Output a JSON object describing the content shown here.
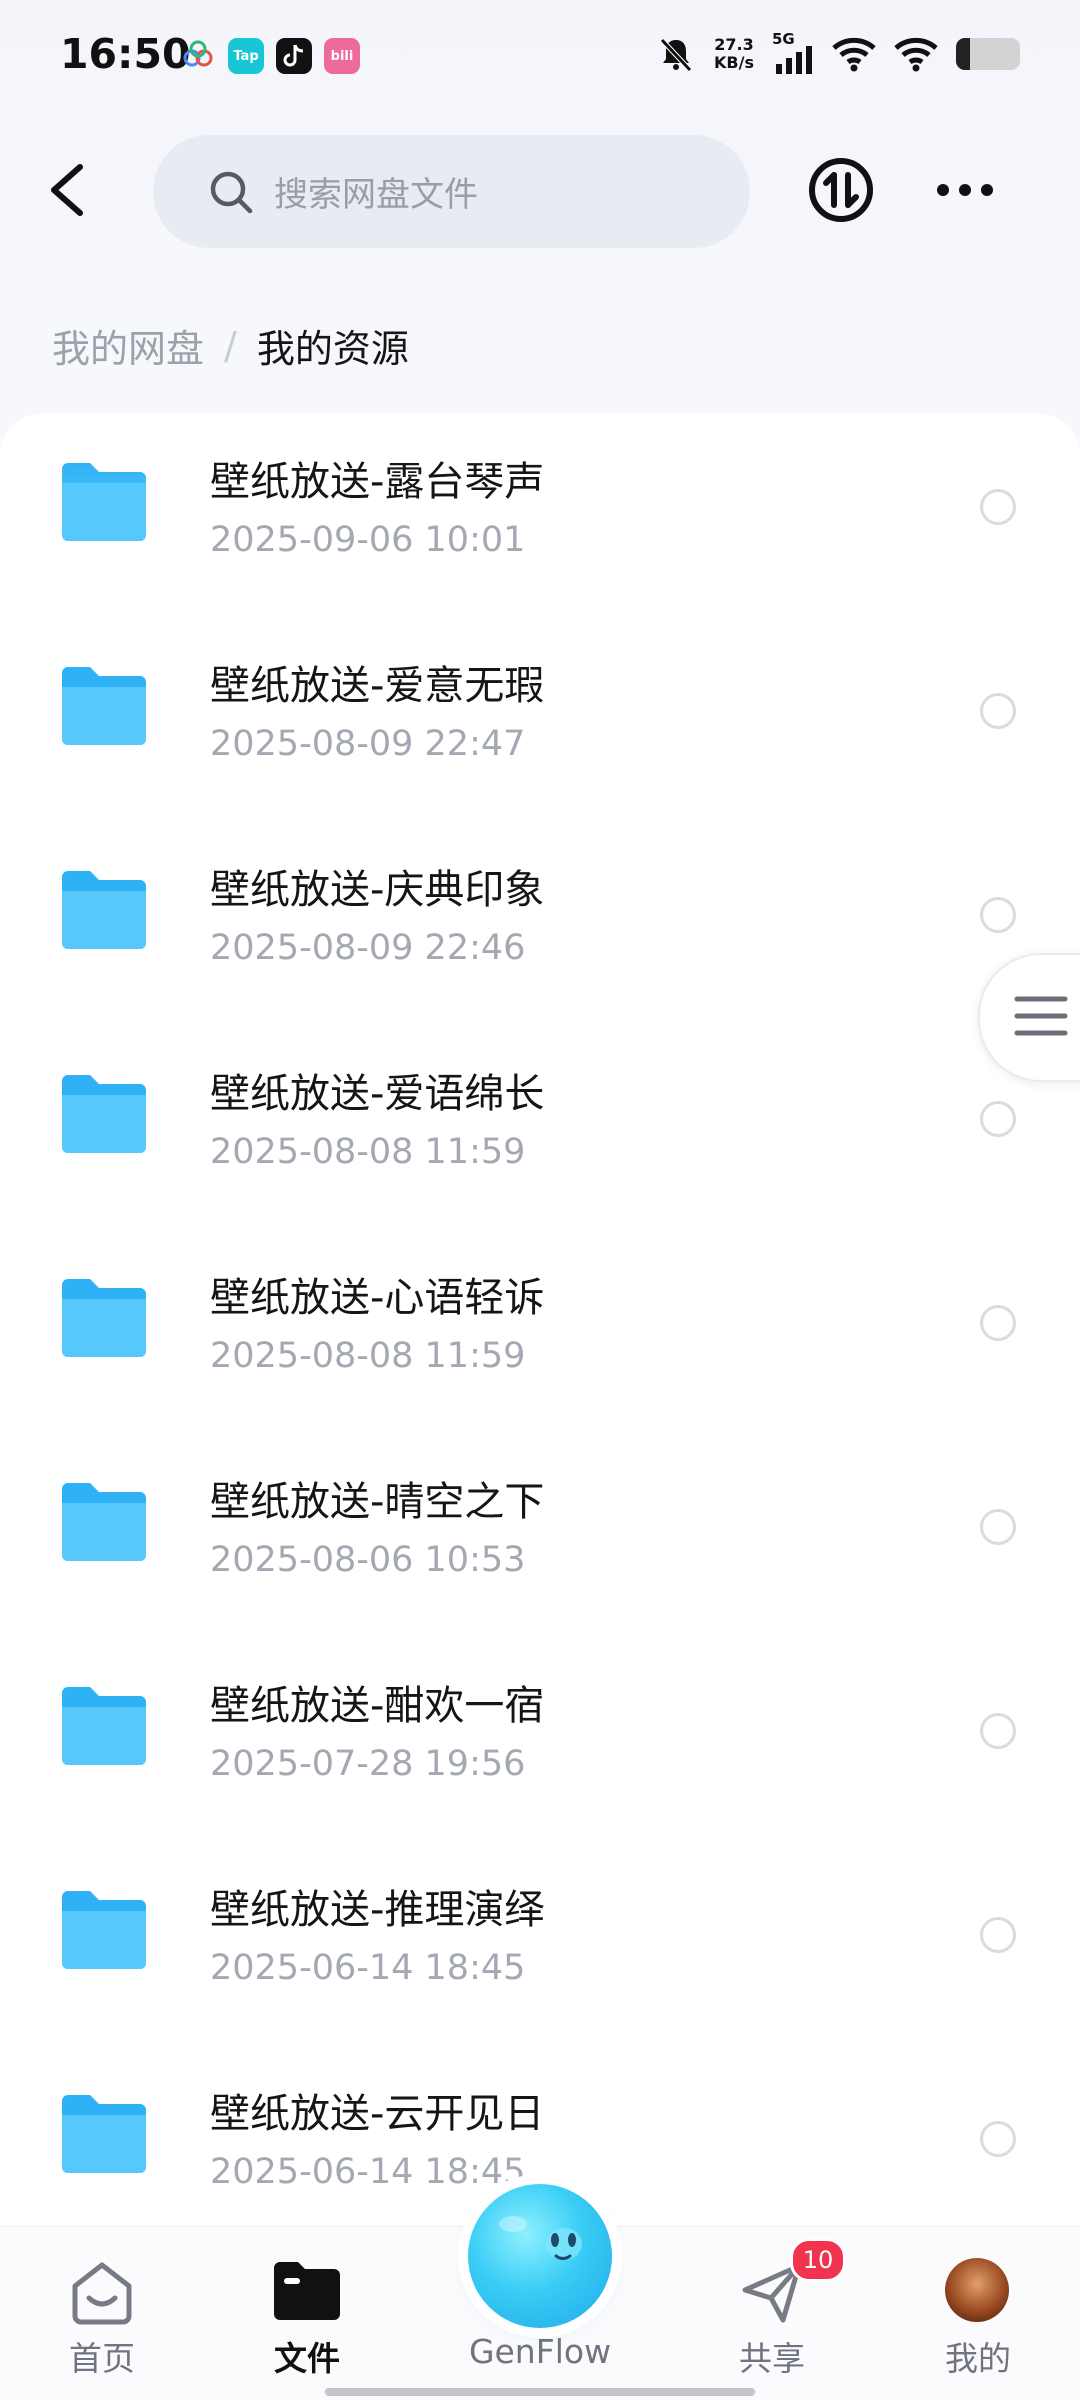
{
  "status_bar": {
    "time": "16:50",
    "net_speed_value": "27.3",
    "net_speed_unit": "KB/s",
    "network": "5G",
    "app_icons": [
      "baidu-netdisk-icon",
      "taptap-icon",
      "tiktok-icon",
      "bilibili-icon"
    ],
    "app_tap_label": "Tap",
    "app_bili_label": "bili"
  },
  "header": {
    "search_placeholder": "搜索网盘文件"
  },
  "breadcrumb": {
    "root": "我的网盘",
    "separator": "/",
    "current": "我的资源"
  },
  "files": [
    {
      "name": "壁纸放送-露台琴声",
      "date": "2025-09-06  10:01"
    },
    {
      "name": "壁纸放送-爱意无瑕",
      "date": "2025-08-09  22:47"
    },
    {
      "name": "壁纸放送-庆典印象",
      "date": "2025-08-09  22:46"
    },
    {
      "name": "壁纸放送-爱语绵长",
      "date": "2025-08-08  11:59"
    },
    {
      "name": "壁纸放送-心语轻诉",
      "date": "2025-08-08  11:59"
    },
    {
      "name": "壁纸放送-晴空之下",
      "date": "2025-08-06  10:53"
    },
    {
      "name": "壁纸放送-酣欢一宿",
      "date": "2025-07-28  19:56"
    },
    {
      "name": "壁纸放送-推理演绎",
      "date": "2025-06-14  18:45"
    },
    {
      "name": "壁纸放送-云开见日",
      "date": "2025-06-14  18:45"
    }
  ],
  "bottom_nav": {
    "home": "首页",
    "files": "文件",
    "genflow": "GenFlow",
    "share": "共享",
    "share_badge": "10",
    "mine": "我的"
  },
  "colors": {
    "folder": "#4cc5fb",
    "accent": "#1fa8e8",
    "badge": "#f2334f"
  }
}
